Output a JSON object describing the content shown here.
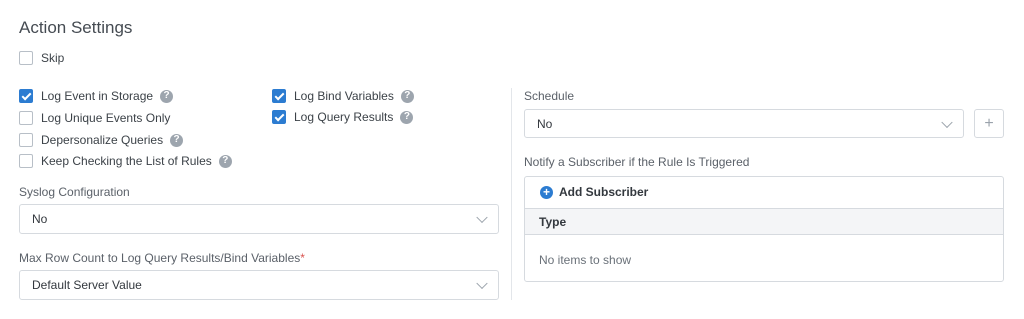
{
  "title": "Action Settings",
  "skip": {
    "label": "Skip",
    "checked": false
  },
  "left_options": [
    {
      "label": "Log Event in Storage",
      "checked": true,
      "help": true
    },
    {
      "label": "Log Unique Events Only",
      "checked": false,
      "help": false
    },
    {
      "label": "Depersonalize Queries",
      "checked": false,
      "help": true
    },
    {
      "label": "Keep Checking the List of Rules",
      "checked": false,
      "help": true
    }
  ],
  "mid_options": [
    {
      "label": "Log Bind Variables",
      "checked": true,
      "help": true
    },
    {
      "label": "Log Query Results",
      "checked": true,
      "help": true
    }
  ],
  "help_glyph": "?",
  "syslog": {
    "label": "Syslog Configuration",
    "value": "No"
  },
  "max_row": {
    "label": "Max Row Count to Log Query Results/Bind Variables",
    "required_mark": "*",
    "value": "Default Server Value"
  },
  "schedule": {
    "label": "Schedule",
    "value": "No",
    "add_glyph": "+"
  },
  "notify": {
    "label": "Notify a Subscriber if the Rule Is Triggered",
    "add_label": "Add Subscriber",
    "add_glyph": "+",
    "column": "Type",
    "empty": "No items to show"
  },
  "colors": {
    "accent": "#2c7cd1",
    "border": "#d6dadf"
  }
}
